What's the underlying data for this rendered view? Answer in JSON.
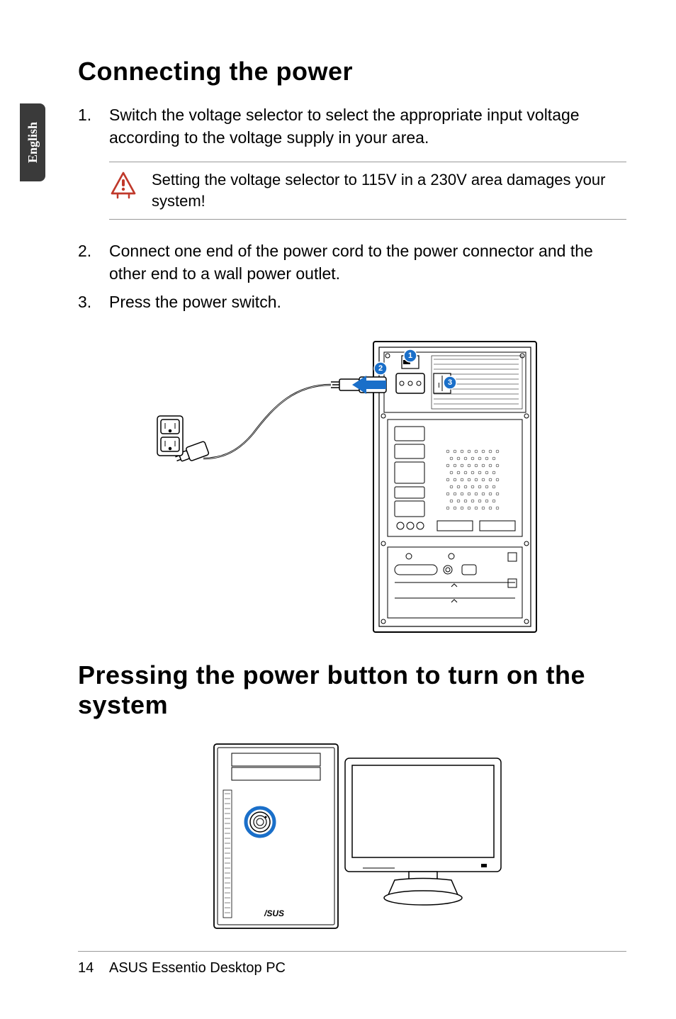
{
  "language_tab": "English",
  "heading1": "Connecting the power",
  "step1_num": "1.",
  "step1_text": "Switch the voltage selector to select the appropriate input voltage according to the voltage supply in your area.",
  "warning_text": "Setting the voltage selector to 115V in a 230V area damages your system!",
  "step2_num": "2.",
  "step2_text": "Connect one end of the power cord to the power connector and the other end to a wall power outlet.",
  "step3_num": "3.",
  "step3_text": "Press the power switch.",
  "heading2": "Pressing the power button to turn on the system",
  "footer_page": "14",
  "footer_text": "ASUS Essentio Desktop PC",
  "callouts": {
    "c1": "1",
    "c2": "2",
    "c3": "3"
  }
}
